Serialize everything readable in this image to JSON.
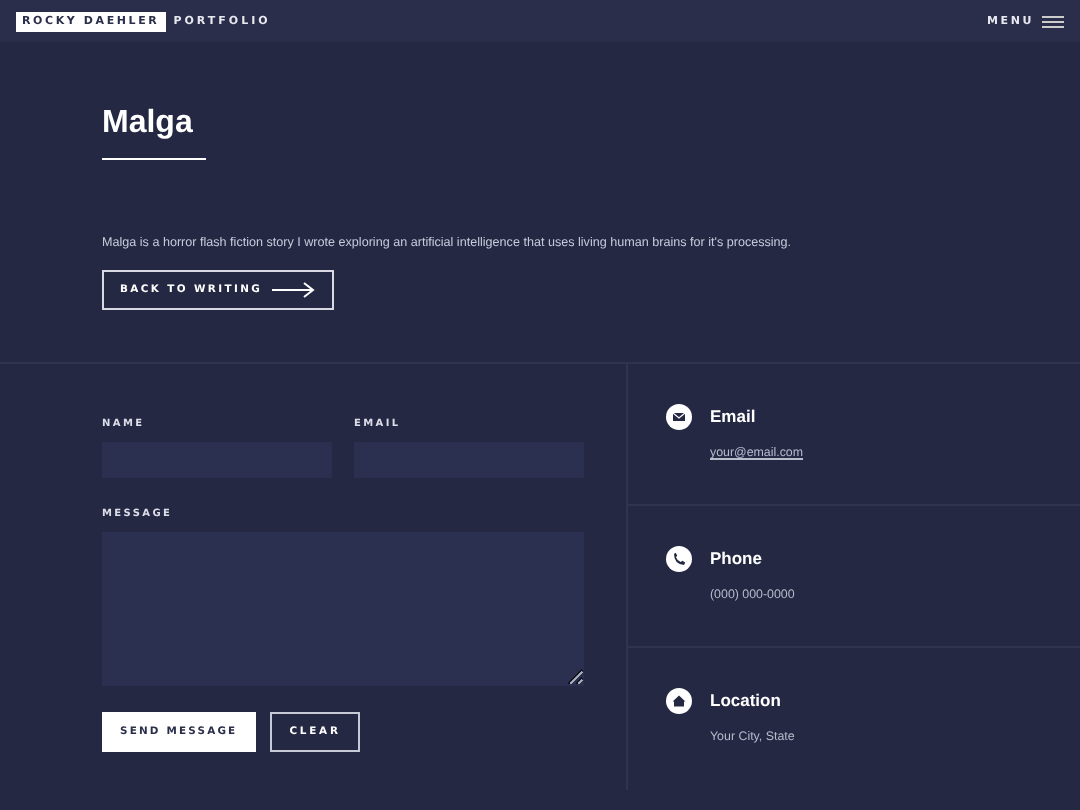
{
  "header": {
    "brand": "ROCKY DAEHLER",
    "section": "PORTFOLIO",
    "menu": "MENU"
  },
  "title": "Malga",
  "description": "Malga is a horror flash fiction story I wrote exploring an artificial intelligence that uses living human brains for it's processing.",
  "back_button": "BACK TO WRITING",
  "form": {
    "name_label": "NAME",
    "email_label": "EMAIL",
    "message_label": "MESSAGE",
    "buttons": [
      {
        "label": "SEND MESSAGE",
        "primary": true
      },
      {
        "label": "CLEAR",
        "primary": false
      }
    ]
  },
  "contacts": [
    {
      "kind": "email",
      "title": "Email",
      "value": "your@email.com",
      "link": true
    },
    {
      "kind": "phone",
      "title": "Phone",
      "value": "(000) 000-0000",
      "link": false
    },
    {
      "kind": "location",
      "title": "Location",
      "value": "Your City, State",
      "link": false
    }
  ]
}
